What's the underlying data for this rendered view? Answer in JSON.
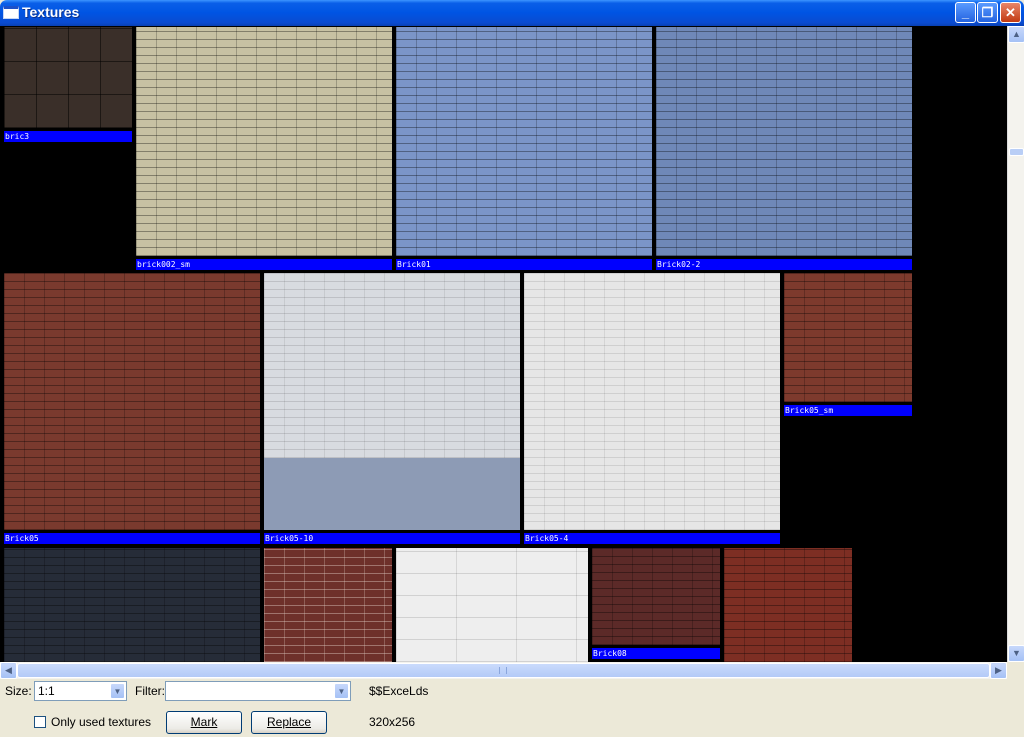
{
  "window": {
    "title": "Textures",
    "min_label": "_",
    "max_label": "❐",
    "close_label": "✕"
  },
  "tiles": [
    {
      "label": "bric3",
      "color": "#3a2f29"
    },
    {
      "label": "brick002_sm",
      "color": "#c7c1a3"
    },
    {
      "label": "Brick01",
      "color": "#7b95c8"
    },
    {
      "label": "Brick02-2",
      "color": "#6f88b8"
    },
    {
      "label": "Brick05",
      "color": "#7a3a2e"
    },
    {
      "label": "Brick05-10",
      "color": "#d8dbe0"
    },
    {
      "label": "Brick05-4",
      "color": "#e6e6e6"
    },
    {
      "label": "Brick05_sm",
      "color": "#7d3a2d"
    },
    {
      "label": "",
      "color": "#262c38"
    },
    {
      "label": "",
      "color": "#6e302a"
    },
    {
      "label": "",
      "color": "#eeeeee"
    },
    {
      "label": "Brick08",
      "color": "#5c2a28"
    },
    {
      "label": "",
      "color": "#7d2e23"
    }
  ],
  "bottom": {
    "size_label": "Size:",
    "size_value": "1:1",
    "filter_label": "Filter:",
    "filter_value": "",
    "selected_name": "$$ExceLds",
    "only_used_label": "Only used textures",
    "mark_label": "Mark",
    "replace_label": "Replace",
    "dimensions": "320x256"
  }
}
